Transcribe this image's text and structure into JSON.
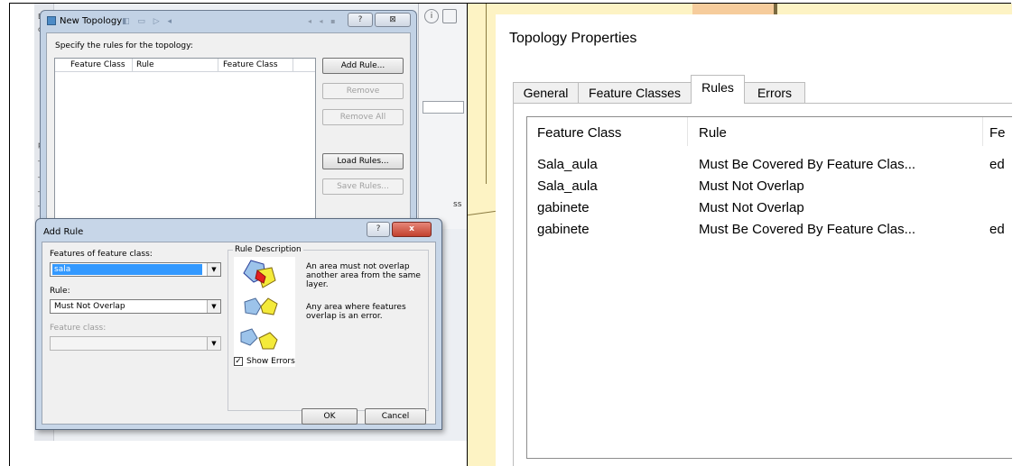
{
  "new_topology": {
    "title": "New Topology",
    "instruction": "Specify the rules for the topology:",
    "columns": [
      "Feature Class",
      "Rule",
      "Feature Class"
    ],
    "buttons": {
      "add_rule": "Add Rule...",
      "remove": "Remove",
      "remove_all": "Remove All",
      "load_rules": "Load Rules...",
      "save_rules": "Save Rules..."
    },
    "help_glyph": "?",
    "close_glyph": "⊠"
  },
  "add_rule": {
    "title": "Add Rule",
    "help_glyph": "?",
    "close_glyph": "x",
    "features_label": "Features of feature class:",
    "features_value": "sala",
    "rule_label": "Rule:",
    "rule_value": "Must Not Overlap",
    "feature_class_label": "Feature class:",
    "feature_class_value": "",
    "rule_description_label": "Rule Description",
    "description_1": "An area must not overlap another area from the same layer.",
    "description_2": "Any area where features overlap is an error.",
    "show_errors_label": "Show Errors",
    "show_errors_checked": true,
    "check_glyph": "✓",
    "ok_label": "OK",
    "cancel_label": "Cancel"
  },
  "background": {
    "side_labels": [
      "B",
      "oi",
      "pe",
      "_v",
      "_v",
      "_v",
      "_v"
    ],
    "info_glyph": "i",
    "side_text": "ss"
  },
  "topology_properties": {
    "title": "Topology Properties",
    "tabs": [
      {
        "label": "General",
        "active": false
      },
      {
        "label": "Feature Classes",
        "active": false
      },
      {
        "label": "Rules",
        "active": true
      },
      {
        "label": "Errors",
        "active": false
      }
    ],
    "columns": [
      "Feature Class",
      "Rule",
      "Fe"
    ],
    "rows": [
      {
        "feature_class": "Sala_aula",
        "rule": "Must Be Covered By Feature Clas...",
        "extra": "ed"
      },
      {
        "feature_class": "Sala_aula",
        "rule": "Must Not Overlap",
        "extra": ""
      },
      {
        "feature_class": "gabinete",
        "rule": "Must Not Overlap",
        "extra": ""
      },
      {
        "feature_class": "gabinete",
        "rule": "Must Be Covered By Feature Clas...",
        "extra": "ed"
      }
    ]
  },
  "colors": {
    "selection": "#3399ff",
    "map_background": "#fdf3c4",
    "polygon_blue": "#9cc3ea",
    "polygon_yellow": "#f4ea3a",
    "error_red": "#e32020"
  }
}
